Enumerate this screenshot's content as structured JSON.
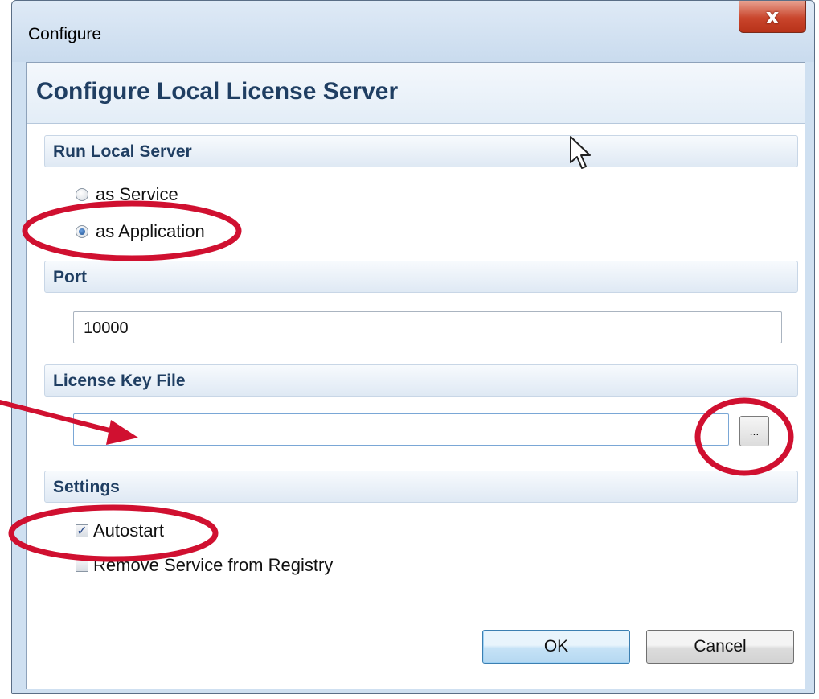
{
  "window": {
    "title": "Configure",
    "close_glyph": "x"
  },
  "header": {
    "title": "Configure Local License Server"
  },
  "run_local_server": {
    "label": "Run Local Server",
    "options": [
      {
        "label": "as Service",
        "selected": false
      },
      {
        "label": "as Application",
        "selected": true
      }
    ]
  },
  "port": {
    "label": "Port",
    "value": "10000"
  },
  "license_key_file": {
    "label": "License Key File",
    "value": "",
    "browse_label": "..."
  },
  "settings": {
    "label": "Settings",
    "autostart": {
      "label": "Autostart",
      "checked": true
    },
    "remove_service": {
      "label": "Remove Service from Registry",
      "checked": false
    }
  },
  "buttons": {
    "ok": "OK",
    "cancel": "Cancel"
  },
  "colors": {
    "annotation": "#d01030",
    "header_text": "#1f3e62",
    "close_button": "#c9452c"
  },
  "icons": {
    "close": "close-icon",
    "cursor": "mouse-pointer-icon",
    "arrow": "annotation-arrow"
  }
}
